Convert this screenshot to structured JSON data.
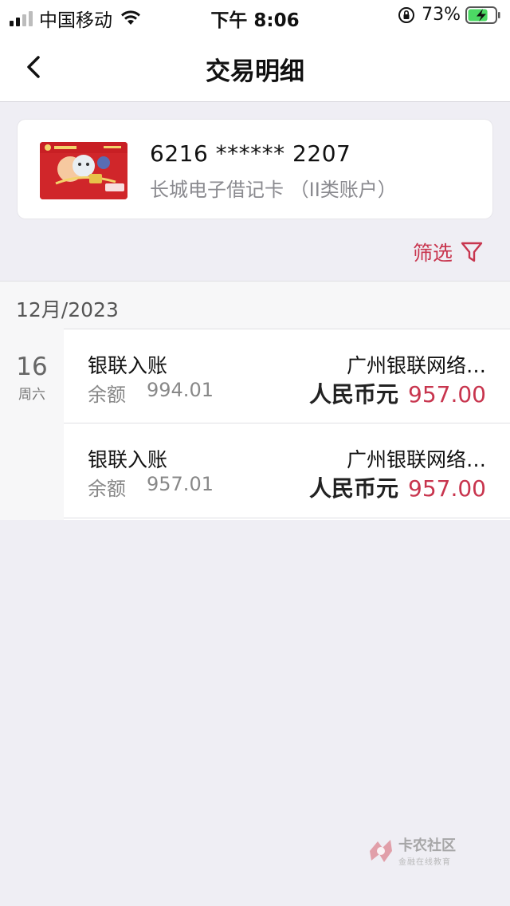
{
  "status_bar": {
    "carrier": "中国移动",
    "time": "下午 8:06",
    "battery_percent": "73%",
    "battery_level": 0.73
  },
  "nav": {
    "title": "交易明细"
  },
  "card": {
    "number": "6216 ****** 2207",
    "type": "长城电子借记卡 （II类账户）"
  },
  "filter": {
    "label": "筛选"
  },
  "month": "12月/2023",
  "date_group": {
    "day": "16",
    "weekday": "周六"
  },
  "transactions": [
    {
      "type": "银联入账",
      "balance_label": "余额",
      "balance": "994.01",
      "merchant": "广州银联网络…",
      "currency": "人民币元",
      "amount": "957.00"
    },
    {
      "type": "银联入账",
      "balance_label": "余额",
      "balance": "957.01",
      "merchant": "广州银联网络…",
      "currency": "人民币元",
      "amount": "957.00"
    }
  ],
  "watermark": {
    "title": "卡农社区",
    "subtitle": "金融在线教育"
  },
  "colors": {
    "accent": "#c8354e",
    "background": "#efeef4"
  }
}
